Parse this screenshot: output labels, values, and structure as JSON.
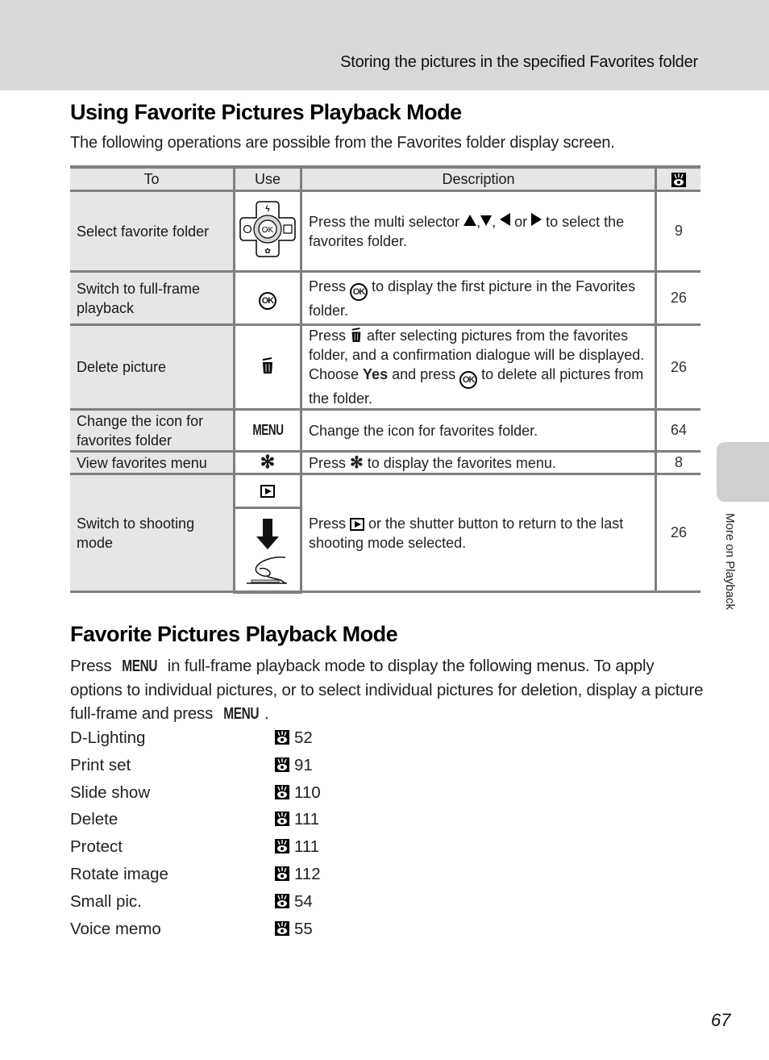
{
  "header": {
    "title": "Storing the pictures in the specified Favorites folder"
  },
  "section1": {
    "heading": "Using Favorite Pictures Playback Mode",
    "intro": "The following operations are possible from the Favorites folder display screen.",
    "table": {
      "columns": [
        "To",
        "Use",
        "Description",
        "reference-icon"
      ],
      "rows": [
        {
          "to": "Select favorite folder",
          "use_icon": "multi-selector-icon",
          "desc_parts": [
            "Press the multi selector ",
            ",",
            ",  ",
            " or ",
            " to select the favorites folder."
          ],
          "ref": "9"
        },
        {
          "to": "Switch to full-frame playback",
          "use_icon": "ok-button-icon",
          "desc_parts": [
            "Press ",
            " to display the first picture in the Favorites folder."
          ],
          "ref": "26"
        },
        {
          "to": "Delete picture",
          "use_icon": "trash-icon",
          "desc_parts": [
            "Press ",
            " after selecting pictures from the favorites folder, and a confirmation dialogue will be displayed. Choose ",
            "Yes",
            " and press ",
            " to delete all pictures from the folder."
          ],
          "ref": "26"
        },
        {
          "to": "Change the icon for favorites folder",
          "use_icon": "menu-button-icon",
          "use_text": "MENU",
          "desc_parts": [
            "Change the icon for favorites folder."
          ],
          "ref": "64"
        },
        {
          "to": "View favorites menu",
          "use_icon": "favorites-star-icon",
          "desc_parts": [
            "Press ",
            " to display the favorites menu."
          ],
          "ref": "8"
        },
        {
          "to": "Switch to shooting mode",
          "use_icon": "playback-button-icon",
          "use_icon_2": "shutter-button-icon",
          "desc_parts": [
            "Press ",
            " or the shutter button to return to the last shooting mode selected."
          ],
          "ref": "26"
        }
      ]
    }
  },
  "section2": {
    "heading": "Favorite Pictures Playback Mode",
    "para_parts": [
      "Press ",
      "MENU",
      " in full-frame playback mode to display the following menus. To apply options to individual pictures, or to select individual pictures for deletion, display a picture full-frame and press ",
      "MENU",
      "."
    ],
    "menus": [
      {
        "label": "D-Lighting",
        "page": "52"
      },
      {
        "label": "Print set",
        "page": "91"
      },
      {
        "label": "Slide show",
        "page": "110"
      },
      {
        "label": "Delete",
        "page": "111"
      },
      {
        "label": "Protect",
        "page": "111"
      },
      {
        "label": "Rotate image",
        "page": "112"
      },
      {
        "label": "Small pic.",
        "page": "54"
      },
      {
        "label": "Voice memo",
        "page": "55"
      }
    ]
  },
  "side_tab": {
    "label": "More on Playback"
  },
  "page_number": "67",
  "colors": {
    "header_band": "#d9d9d9",
    "table_border": "#7f7f7f",
    "table_label_bg": "#e6e6e6",
    "side_tab": "#d0d0d0"
  }
}
